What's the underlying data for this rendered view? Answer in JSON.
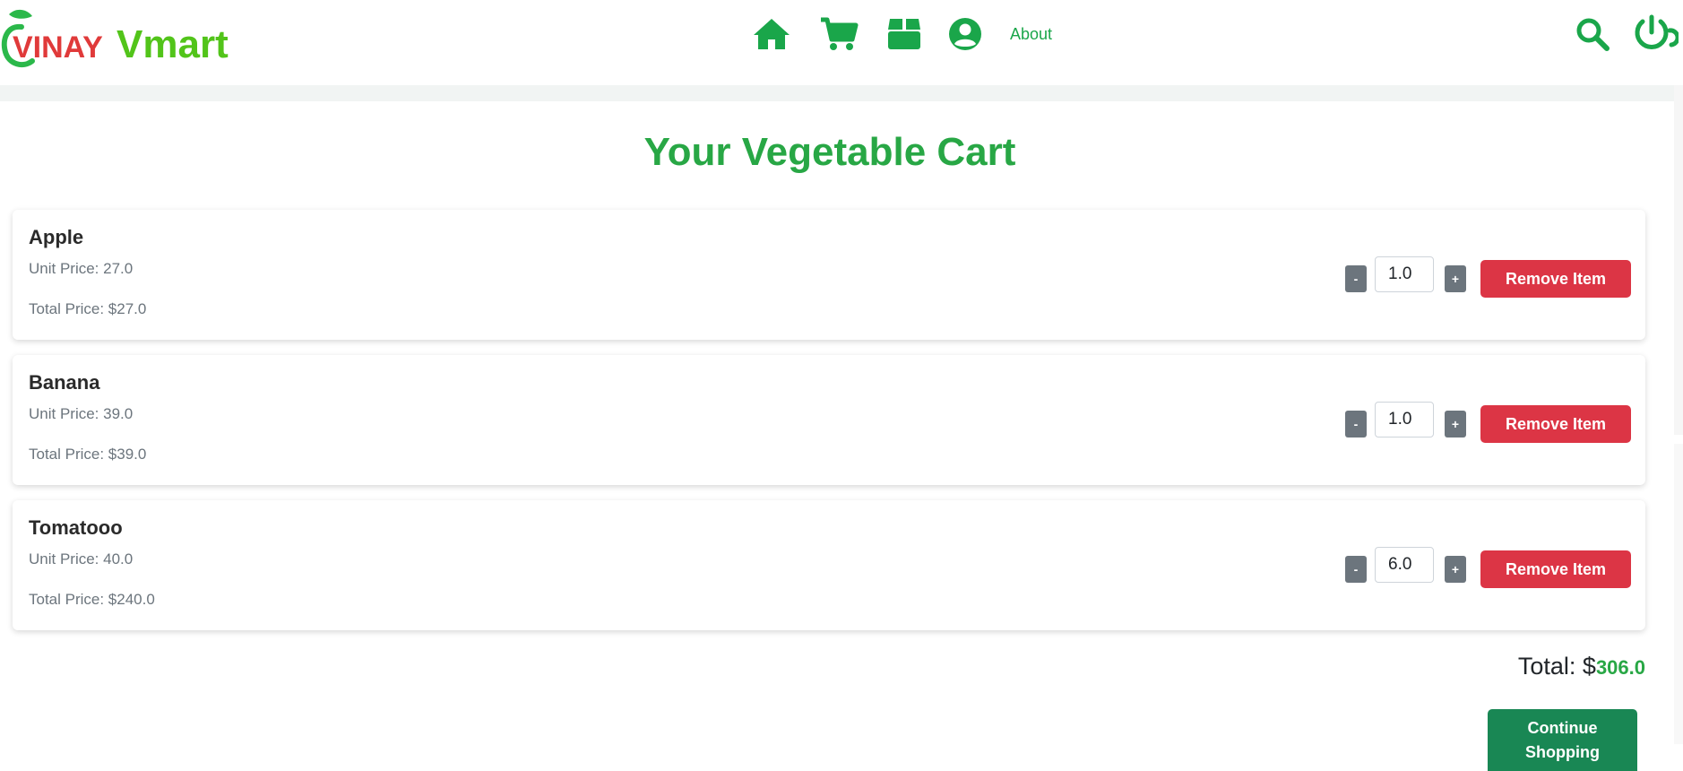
{
  "brand": {
    "word1": "VINAY",
    "word2": "Vmart"
  },
  "nav": {
    "about_label": "About"
  },
  "icons": {
    "home": "home-icon",
    "cart": "cart-icon",
    "box": "box-icon",
    "user": "user-circle-icon",
    "search": "search-icon",
    "power": "power-icon"
  },
  "colors": {
    "accent": "#28a745",
    "danger": "#dc3545",
    "dark_green": "#198754",
    "muted": "#6c757d"
  },
  "page": {
    "title": "Your Vegetable Cart"
  },
  "cart": {
    "items": [
      {
        "name": "Apple",
        "unit_price": "Unit Price: 27.0",
        "total_price": "Total Price: $27.0",
        "quantity": "1.0",
        "minus": "-",
        "plus": "+",
        "remove_label": "Remove Item"
      },
      {
        "name": "Banana",
        "unit_price": "Unit Price: 39.0",
        "total_price": "Total Price: $39.0",
        "quantity": "1.0",
        "minus": "-",
        "plus": "+",
        "remove_label": "Remove Item"
      },
      {
        "name": "Tomatooo",
        "unit_price": "Unit Price: 40.0",
        "total_price": "Total Price: $240.0",
        "quantity": "6.0",
        "minus": "-",
        "plus": "+",
        "remove_label": "Remove Item"
      }
    ],
    "total_label": "Total: $",
    "total_value": "306.0",
    "continue_label": "Continue Shopping"
  }
}
